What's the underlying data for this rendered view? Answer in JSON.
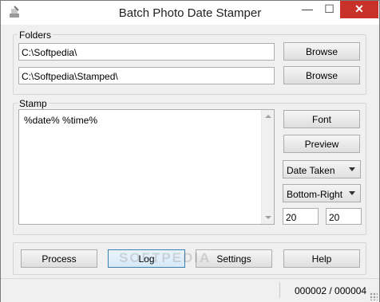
{
  "window": {
    "title": "Batch Photo Date Stamper",
    "minimize": "—",
    "maximize": "☐",
    "close": "✕"
  },
  "folders": {
    "label": "Folders",
    "source": "C:\\Softpedia\\",
    "destination": "C:\\Softpedia\\Stamped\\",
    "browse_label": "Browse"
  },
  "stamp": {
    "label": "Stamp",
    "text": "%date% %time%",
    "font_label": "Font",
    "preview_label": "Preview",
    "date_source": "Date Taken",
    "position": "Bottom-Right",
    "offset_x": "20",
    "offset_y": "20"
  },
  "actions": {
    "process": "Process",
    "log": "Log",
    "settings": "Settings",
    "help": "Help"
  },
  "status": {
    "counter": "000002 / 000004"
  },
  "watermark": "SOFTPEDIA"
}
